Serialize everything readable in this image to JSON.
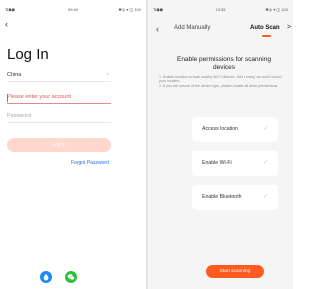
{
  "left": {
    "status": {
      "left_icons": "⇅◼◼",
      "time": "09:49",
      "right_icons": "✱◎ ▾ ◫ 100"
    },
    "back_glyph": "‹",
    "title": "Log In",
    "country": "China",
    "account_placeholder": "Please enter your account",
    "password_placeholder": "Password",
    "login_button": "Log in",
    "forgot_password": "Forgot Password",
    "social": [
      {
        "icon": "drop-icon",
        "color": "#1e8af3"
      },
      {
        "icon": "wechat-icon",
        "color": "#2bc03a"
      }
    ]
  },
  "right": {
    "status": {
      "left_icons": "⇅◼◼",
      "time": "13:35",
      "right_icons": "✱◎ ▾ ◫ 100"
    },
    "back_glyph": "‹",
    "tabs": [
      {
        "label": "Add Manually",
        "active": false
      },
      {
        "label": "Auto Scan",
        "active": true
      }
    ],
    "accent": "#ff5a1f",
    "title": "Enable permissions for scanning devices",
    "notes": [
      "1. Enable location to scan nearby Wi-Fi devices. Don't worry, we won't record your location.",
      "2. If you are unsure of the device type, please enable all three permissions"
    ],
    "permissions": [
      {
        "label": "Access location"
      },
      {
        "label": "Enable Wi-Fi"
      },
      {
        "label": "Enable Bluetooth"
      }
    ],
    "start_button": "Start scanning"
  }
}
